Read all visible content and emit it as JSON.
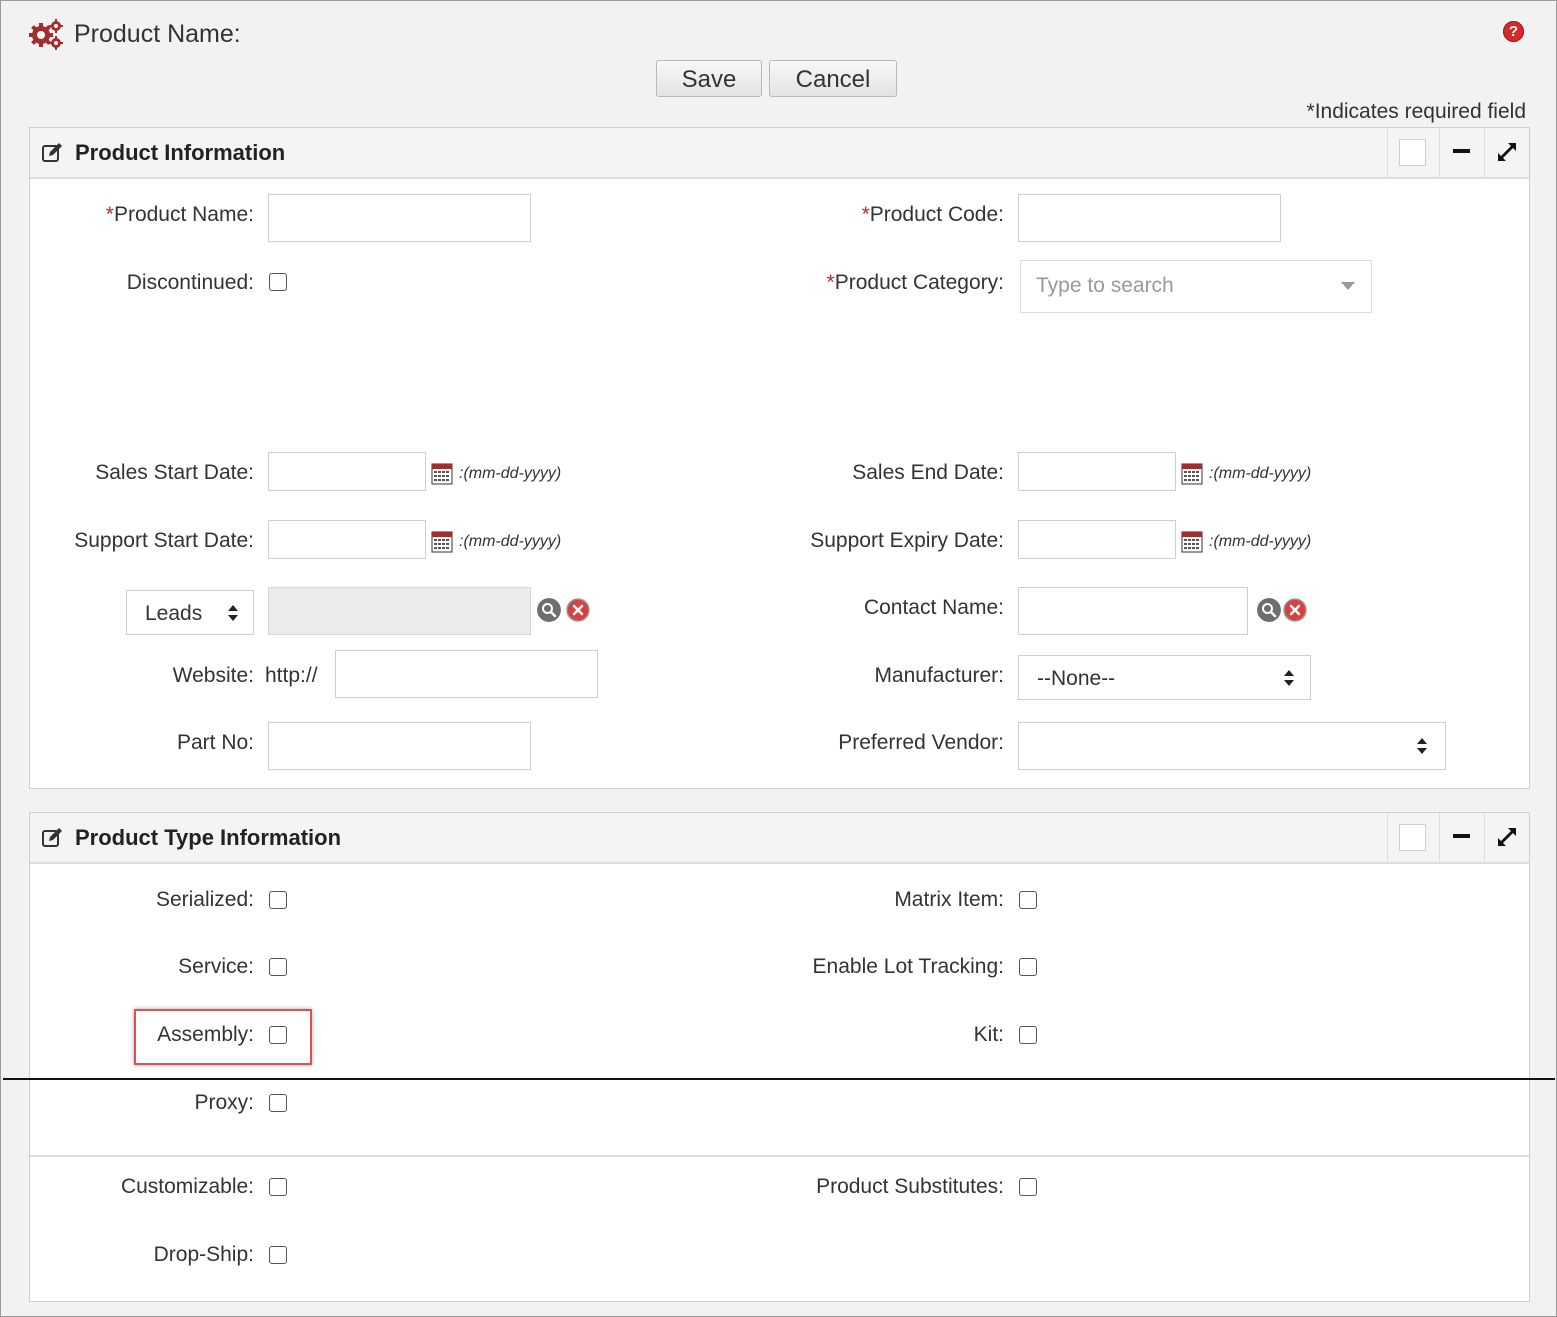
{
  "header": {
    "title": "Product Name:",
    "save_label": "Save",
    "cancel_label": "Cancel",
    "required_note": "*Indicates required field",
    "help_glyph": "?"
  },
  "colors": {
    "required_star": "#c0292b",
    "accent_red": "#a32d2d",
    "highlight": "#d9534f"
  },
  "product_information": {
    "title": "Product Information",
    "required_marker": "*",
    "fields": {
      "product_name": "Product Name:",
      "product_code": "Product Code:",
      "discontinued": "Discontinued:",
      "product_category": "Product Category:",
      "category_placeholder": "Type to search",
      "sales_start_date": "Sales Start Date:",
      "sales_end_date": "Sales End Date:",
      "support_start_date": "Support Start Date:",
      "support_expiry_date": "Support Expiry Date:",
      "date_format": ":(mm-dd-yyyy)",
      "related_type": "Leads",
      "contact_name": "Contact Name:",
      "website": "Website:",
      "website_prefix": "http://",
      "manufacturer": "Manufacturer:",
      "manufacturer_value": "--None--",
      "part_no": "Part No:",
      "preferred_vendor": "Preferred Vendor:"
    }
  },
  "product_type_information": {
    "title": "Product Type Information",
    "fields": {
      "serialized": "Serialized:",
      "matrix_item": "Matrix Item:",
      "service": "Service:",
      "enable_lot_tracking": "Enable Lot Tracking:",
      "assembly": "Assembly:",
      "kit": "Kit:",
      "proxy": "Proxy:",
      "customizable": "Customizable:",
      "product_substitutes": "Product Substitutes:",
      "drop_ship": "Drop-Ship:"
    }
  },
  "icons": [
    "gears-icon",
    "help-icon",
    "edit-icon",
    "box-icon",
    "minimize-icon",
    "expand-icon",
    "calendar-icon",
    "search-icon",
    "clear-icon",
    "chevron-down-icon",
    "updown-icon"
  ]
}
